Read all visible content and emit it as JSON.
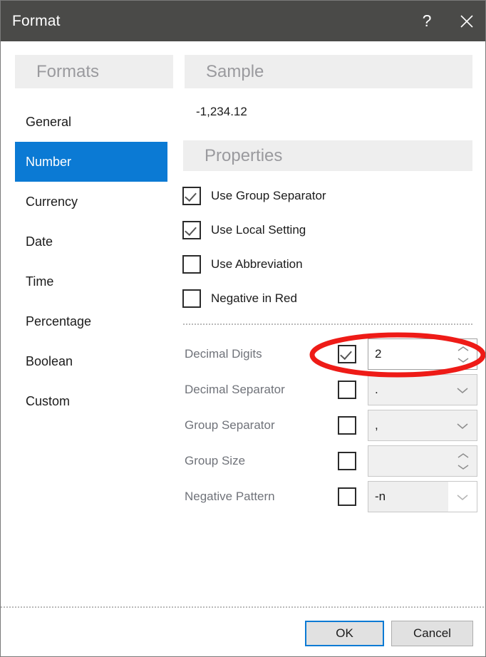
{
  "window": {
    "title": "Format",
    "help_icon": "question-mark-icon",
    "help_label": "?",
    "close_icon": "close-icon"
  },
  "headers": {
    "formats": "Formats",
    "sample": "Sample",
    "properties": "Properties"
  },
  "sidebar": {
    "items": [
      {
        "label": "General",
        "selected": false
      },
      {
        "label": "Number",
        "selected": true
      },
      {
        "label": "Currency",
        "selected": false
      },
      {
        "label": "Date",
        "selected": false
      },
      {
        "label": "Time",
        "selected": false
      },
      {
        "label": "Percentage",
        "selected": false
      },
      {
        "label": "Boolean",
        "selected": false
      },
      {
        "label": "Custom",
        "selected": false
      }
    ]
  },
  "sample": {
    "value": "-1,234.12"
  },
  "properties": {
    "checkboxes": [
      {
        "label": "Use Group Separator",
        "checked": true
      },
      {
        "label": "Use Local Setting",
        "checked": true
      },
      {
        "label": "Use Abbreviation",
        "checked": false
      },
      {
        "label": "Negative in Red",
        "checked": false
      }
    ],
    "fields": [
      {
        "label": "Decimal Digits",
        "checked": true,
        "value": "2",
        "control": "spinner",
        "enabled": true
      },
      {
        "label": "Decimal Separator",
        "checked": false,
        "value": ".",
        "control": "dropdown",
        "enabled": false
      },
      {
        "label": "Group Separator",
        "checked": false,
        "value": ",",
        "control": "dropdown",
        "enabled": false
      },
      {
        "label": "Group Size",
        "checked": false,
        "value": "",
        "control": "spinner",
        "enabled": false
      },
      {
        "label": "Negative Pattern",
        "checked": false,
        "value": "-n",
        "control": "dropdown-split",
        "enabled": false
      }
    ]
  },
  "footer": {
    "ok_label": "OK",
    "cancel_label": "Cancel"
  },
  "annotation": {
    "shape": "ellipse",
    "color": "#ee1b17",
    "target": "Decimal Digits checkbox and value field"
  },
  "colors": {
    "titlebar": "#4a4a48",
    "accent": "#0b7ad4",
    "header_band": "#eeeeee",
    "label_gray": "#70737a",
    "disabled_field": "#f0f0f0",
    "annotation_red": "#ee1b17"
  }
}
